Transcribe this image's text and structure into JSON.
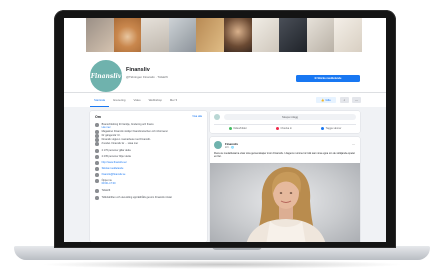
{
  "page": {
    "avatar_text": "Finansliv",
    "name": "Finansliv",
    "handle": "@Tidningen Finansliv · Tidskrift",
    "follow_label": "✉ Skicka meddelande",
    "like_label": "👍 Gilla",
    "search_icon": "⌕",
    "more_icon": "⋯"
  },
  "tabs": [
    {
      "label": "Startsida",
      "active": true
    },
    {
      "label": "Grenering",
      "active": false
    },
    {
      "label": "Video",
      "active": false
    },
    {
      "label": "Webbshop",
      "active": false
    },
    {
      "label": "Mer ▾",
      "active": false
    }
  ],
  "about": {
    "title": "Om",
    "see_all": "Visa alla",
    "rows": [
      {
        "text": "Branschtidning för familje, fondering och finans",
        "sub": "Läs mer"
      },
      {
        "text": "Magasinet Finansliv stödjer finansbranschen och informerar",
        "sub": ""
      },
      {
        "text": "för gängen/är I.F.",
        "sub": ""
      },
      {
        "text": "Finansliv utgiven i samarbete med Finansfö-",
        "sub": ""
      },
      {
        "text": "rbundet. Finansliv är ... Läsa mer",
        "sub": ""
      },
      {
        "text": "2 176 personer gillar detta",
        "sub": ""
      },
      {
        "text": "2 235 personer följer detta",
        "sub": ""
      },
      {
        "text": "http://www.finansliv.se/",
        "sub": ""
      },
      {
        "text": "Skicka meddelande",
        "sub": ""
      },
      {
        "text": "finansliv@finansliv.se",
        "sub": ""
      },
      {
        "text": "Öppet nu",
        "sub": "09:00–17:00"
      },
      {
        "text": "Tidskrift",
        "sub": ""
      },
      {
        "text": "Tidtidskriften och utveckling upprätthålls genom Finansliv röstat",
        "sub": ""
      }
    ]
  },
  "composer": {
    "placeholder": "Skapa inlägg",
    "actions": [
      {
        "label": "Video/bilder",
        "color": "#45bd62"
      },
      {
        "label": "Checka in",
        "color": "#f02849"
      },
      {
        "label": "Tagga vänner",
        "color": "#1877f2"
      }
    ]
  },
  "post": {
    "author": "Finansliv",
    "time": "22 t · 🌐",
    "more": "⋯",
    "text": "Flera av medarbetarna visar sina gemenskaper inom Finansliv. I dagens nummer är tolk sam sina egna om de stödjande-spelet en fler."
  }
}
